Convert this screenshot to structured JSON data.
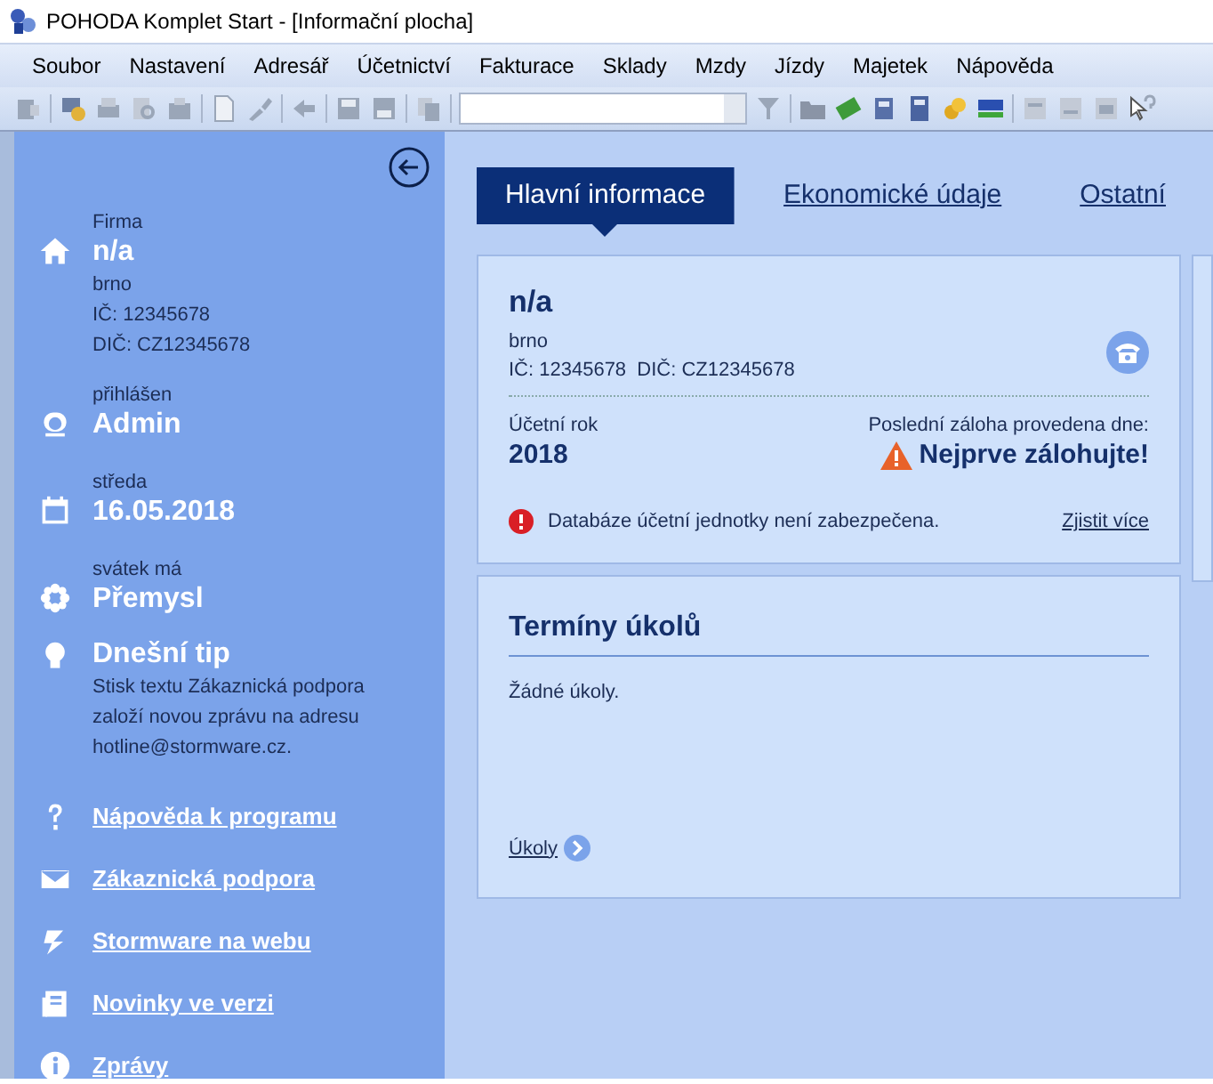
{
  "window": {
    "title": "POHODA Komplet Start - [Informační plocha]"
  },
  "menu": [
    {
      "label": "Soubor"
    },
    {
      "label": "Nastavení"
    },
    {
      "label": "Adresář"
    },
    {
      "label": "Účetnictví"
    },
    {
      "label": "Fakturace"
    },
    {
      "label": "Sklady"
    },
    {
      "label": "Mzdy"
    },
    {
      "label": "Jízdy"
    },
    {
      "label": "Majetek"
    },
    {
      "label": "Nápověda"
    }
  ],
  "sidebar": {
    "sections": [
      {
        "kind": "home",
        "label": "Firma",
        "value": "n/a",
        "lines": [
          "brno",
          "IČ: 12345678",
          "DIČ: CZ12345678"
        ]
      },
      {
        "kind": "user",
        "label": "přihlášen",
        "value": "Admin"
      },
      {
        "kind": "calendar",
        "label": "středa",
        "value": "16.05.2018"
      },
      {
        "kind": "flower",
        "label": "svátek má",
        "value": "Přemysl"
      }
    ],
    "tip": {
      "title": "Dnešní tip",
      "text": "Stisk textu Zákaznická podpora založí novou zprávu na adresu hotline@stormware.cz."
    },
    "links": [
      {
        "kind": "help",
        "label": "Nápověda k programu"
      },
      {
        "kind": "mail",
        "label": "Zákaznická podpora"
      },
      {
        "kind": "web",
        "label": "Stormware na webu"
      },
      {
        "kind": "news",
        "label": "Novinky ve verzi"
      },
      {
        "kind": "info",
        "label": "Zprávy"
      }
    ]
  },
  "tabs": [
    {
      "label": "Hlavní informace",
      "selected": true
    },
    {
      "label": "Ekonomické údaje",
      "selected": false
    },
    {
      "label": "Ostatní",
      "selected": false
    }
  ],
  "company_card": {
    "name": "n/a",
    "city": "brno",
    "ids": "IČ: 12345678  DIČ: CZ12345678",
    "year_label": "Účetní rok",
    "year": "2018",
    "backup_label": "Poslední záloha provedena dne:",
    "backup_value": "Nejprve zálohujte!",
    "warning": "Databáze účetní jednotky není zabezpečena.",
    "warning_link": "Zjistit více"
  },
  "tasks_card": {
    "title": "Termíny úkolů",
    "empty": "Žádné úkoly.",
    "link": "Úkoly"
  }
}
